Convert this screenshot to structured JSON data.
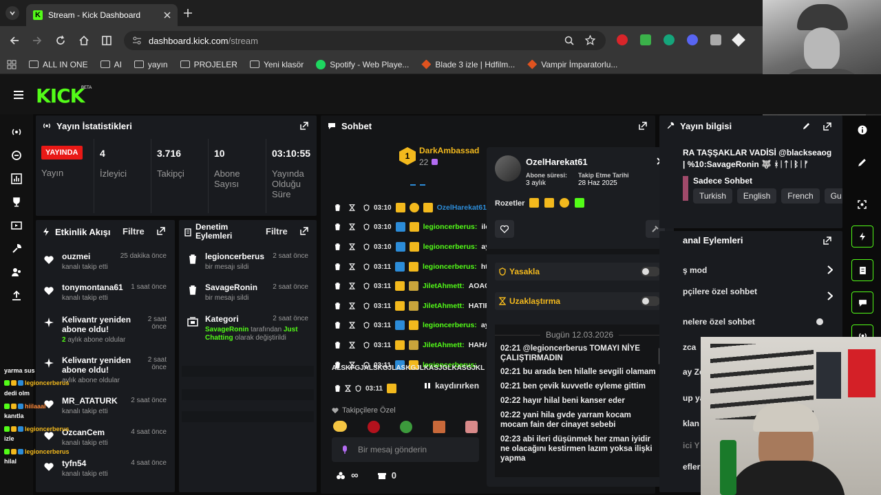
{
  "browser": {
    "tab_title": "Stream - Kick Dashboard",
    "url_host": "dashboard.kick.com",
    "url_path": "/stream",
    "bookmarks": [
      "ALL IN ONE",
      "AI",
      "yayın",
      "PROJELER",
      "Yeni klasör",
      "Spotify - Web Playe...",
      "Blade 3 izle | Hdfilm...",
      "Vampir İmparatorlu..."
    ]
  },
  "brand": {
    "logo": "KICK",
    "beta": "BETA",
    "accent": "#53fc18"
  },
  "stats": {
    "title": "Yayın İstatistikleri",
    "live_badge": "YAYINDA",
    "live_label": "Yayın",
    "viewers": "4",
    "viewers_label": "İzleyici",
    "followers": "3.716",
    "followers_label": "Takipçi",
    "subs": "10",
    "subs_label": "Abone Sayısı",
    "uptime": "03:10:55",
    "uptime_label": "Yayında Olduğu Süre"
  },
  "activity": {
    "title": "Etkinlik Akışı",
    "filter": "Filtre",
    "items": [
      {
        "name": "ouzmei",
        "desc": "kanalı takip etti",
        "ago": "25 dakika önce"
      },
      {
        "name": "tonymontana61",
        "desc": "kanalı takip etti",
        "ago": "1 saat önce"
      },
      {
        "name": "Kelivantr yeniden abone oldu!",
        "desc": "aylık abone oldular",
        "months": "2",
        "ago": "2 saat önce"
      },
      {
        "name": "Kelivantr yeniden abone oldu!",
        "desc": "aylık abone oldular",
        "ago": "2 saat önce"
      },
      {
        "name": "MR_ATATURK",
        "desc": "kanalı takip etti",
        "ago": "2 saat önce"
      },
      {
        "name": "OzcanCem",
        "desc": "kanalı takip etti",
        "ago": "4 saat önce"
      },
      {
        "name": "tyfn54",
        "desc": "kanalı takip etti",
        "ago": "4 saat önce"
      }
    ]
  },
  "moderation": {
    "title": "Denetim Eylemleri",
    "filter": "Filtre",
    "items": [
      {
        "name": "legioncerberus",
        "desc": "bir mesajı sildi",
        "ago": "2 saat önce"
      },
      {
        "name": "SavageRonin",
        "desc": "bir mesajı sildi",
        "ago": "2 saat önce"
      },
      {
        "name": "Kategori",
        "user": "SavageRonin",
        "mid": "tarafından",
        "cat": "Just Chatting",
        "tail": "olarak değiştirildi",
        "ago": "2 saat önce"
      }
    ]
  },
  "chat": {
    "title": "Sohbet",
    "top_user": "DarkAmbassad",
    "top_count": "22",
    "rows": [
      {
        "time": "03:10",
        "user": "OzelHarekat61",
        "msg": ""
      },
      {
        "time": "03:10",
        "user": "legioncerberus:",
        "msg": "ile"
      },
      {
        "time": "03:10",
        "user": "legioncerberus:",
        "msg": "ay"
      },
      {
        "time": "03:11",
        "user": "legioncerberus:",
        "msg": "ht"
      },
      {
        "time": "03:11",
        "user": "JiletAhmett:",
        "msg": "AOAC"
      },
      {
        "time": "03:11",
        "user": "JiletAhmett:",
        "msg": "HATIF"
      },
      {
        "time": "03:11",
        "user": "legioncerberus:",
        "msg": "ay"
      },
      {
        "time": "03:11",
        "user": "JiletAhmett:",
        "msg": "HAHA"
      },
      {
        "time": "03:11",
        "user": "legioncerberus:",
        "msg": ""
      }
    ],
    "wrap_line": "ALSKFGJALSKGJLASKGJLKASJGLKASGJKL",
    "paused": "kaydırırken",
    "last_time": "03:11",
    "sub_only": "Takipçilere Özel",
    "input_placeholder": "Bir mesaj gönderin",
    "infinity": "∞",
    "gift_count": "0"
  },
  "usercard": {
    "name": "OzelHarekat61",
    "sub_label": "Abone süresi:",
    "sub_value": "3 aylık",
    "follow_label": "Takip Etme Tarihi",
    "follow_value": "28 Haz 2025",
    "badges_label": "Rozetler",
    "ban_label": "Yasakla",
    "timeout_label": "Uzaklaştırma",
    "date_sep": "Bugün 12.03.2026",
    "history": [
      {
        "time": "02:21",
        "msg": "@legioncerberus TOMAYI NİYE ÇALIŞTIRMADIN"
      },
      {
        "time": "02:21",
        "msg": "bu arada ben hilalle sevgili olamam"
      },
      {
        "time": "02:21",
        "msg": "ben çevik kuvvetle eyleme gittim"
      },
      {
        "time": "02:22",
        "msg": "hayır hilal beni kanser eder"
      },
      {
        "time": "02:22",
        "msg": "yani hila gvde yarram kocam mocam fain der cinayet sebebi"
      },
      {
        "time": "02:23",
        "msg": "abi ileri düşünmek her zman iyidir ne olacağını kestirmen lazım yoksa ilişki yapma"
      }
    ]
  },
  "streaminfo": {
    "title": "Yayın bilgisi",
    "stream_title": "RA TAŞŞAKLAR VADİSİ @blackseaog | %10:SavageRonin 🐺 ᚼᛁᛏᛁᛒᛁᚠ ᚱᛁᛉᛁᚼᛁᛁ...",
    "category": "Sadece Sohbet",
    "tags": [
      "Turkish",
      "English",
      "French",
      "Gu"
    ]
  },
  "channelactions": {
    "title": "anal Eylemleri",
    "items": [
      "ş mod",
      "pçilere özel sohbet",
      "nelere özel sohbet",
      "zca",
      "ay Ze",
      "up ya",
      "klan",
      "ici Y",
      "efler"
    ]
  },
  "overlay": [
    {
      "label": "yarma sus"
    },
    {
      "user": "legioncerberus",
      "label": "dedi olm"
    },
    {
      "user": "hiilaaal",
      "label": "kanıtla"
    },
    {
      "user": "legioncerberus",
      "label": "izle"
    },
    {
      "user": "legioncerberus",
      "label": "hilal"
    }
  ]
}
